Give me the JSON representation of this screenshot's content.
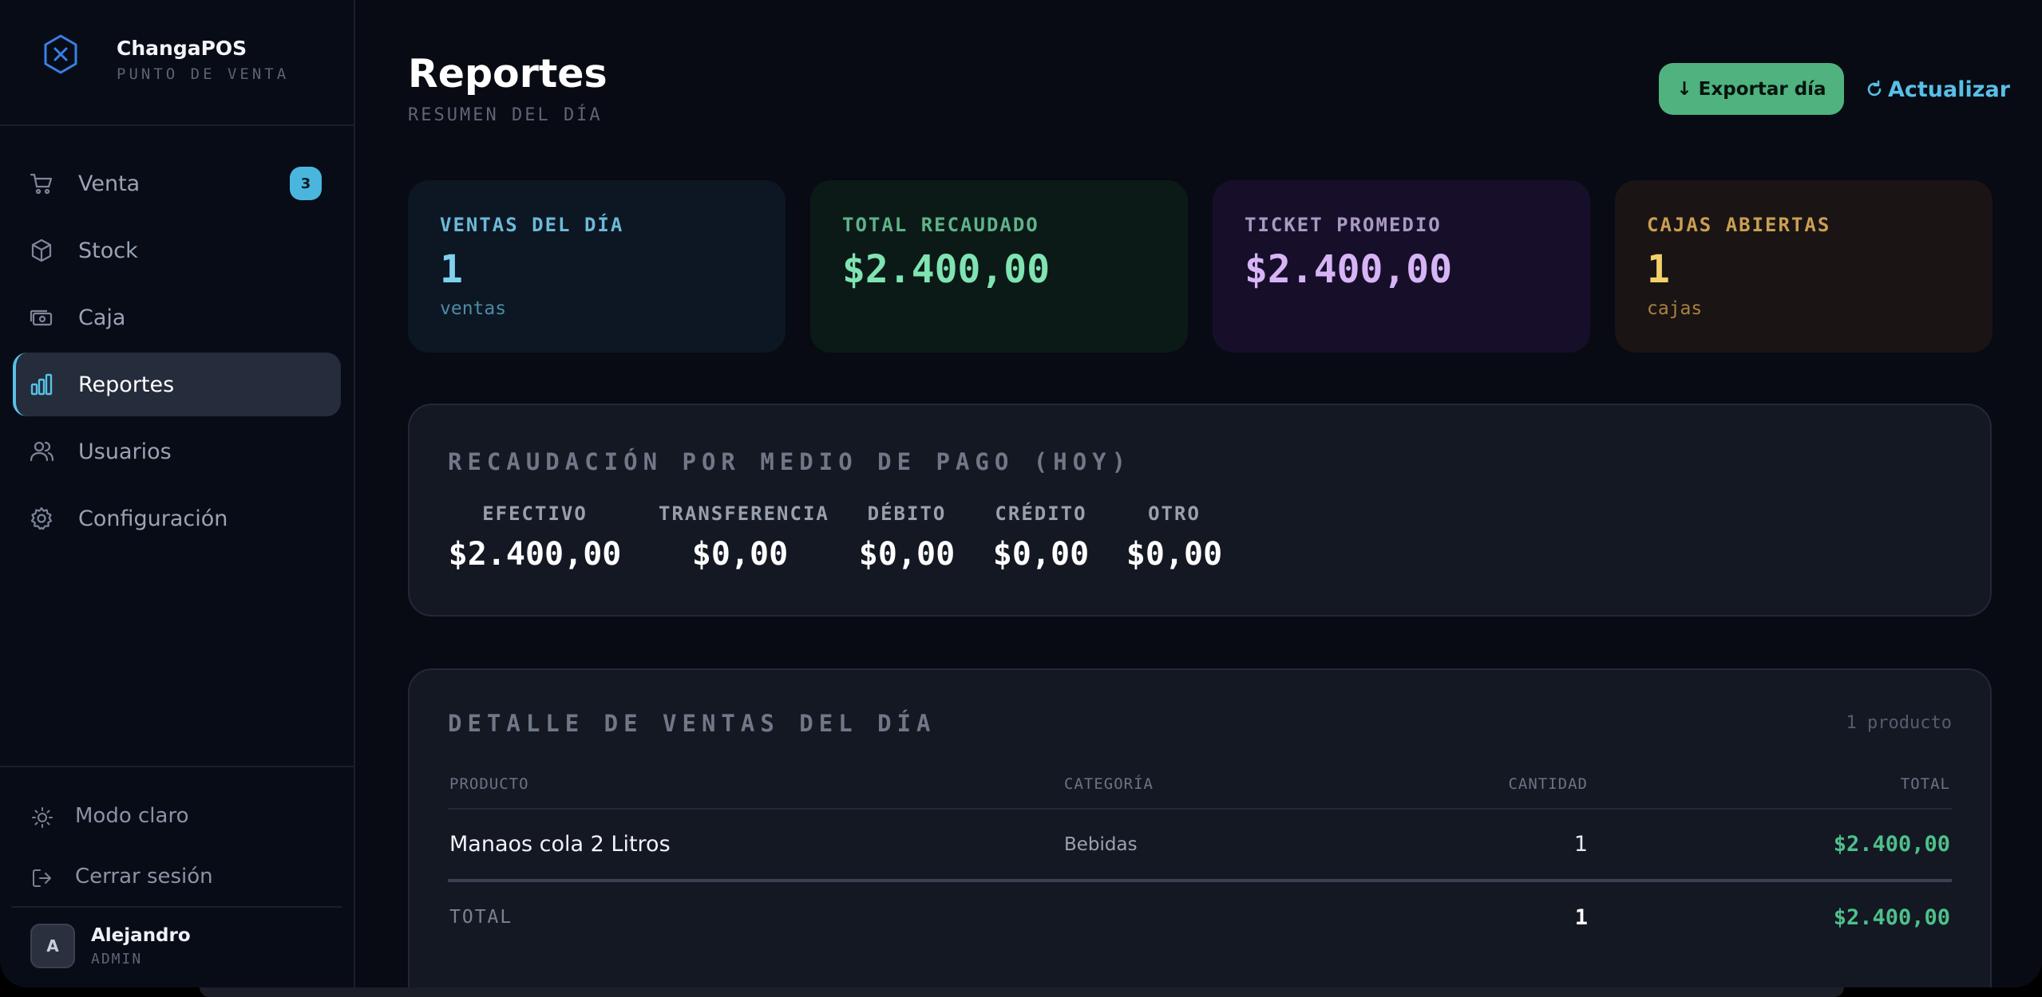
{
  "brand": {
    "name": "ChangaPOS",
    "subtitle": "PUNTO DE VENTA",
    "icon": "hex-x-logo-icon"
  },
  "sidebar": {
    "items": [
      {
        "label": "Venta",
        "icon": "cart-icon",
        "badge": "3"
      },
      {
        "label": "Stock",
        "icon": "box-icon"
      },
      {
        "label": "Caja",
        "icon": "cash-register-icon"
      },
      {
        "label": "Reportes",
        "icon": "bar-chart-icon",
        "active": true
      },
      {
        "label": "Usuarios",
        "icon": "users-icon"
      },
      {
        "label": "Configuración",
        "icon": "gear-icon"
      }
    ],
    "utilities": [
      {
        "label": "Modo claro",
        "icon": "sun-icon"
      },
      {
        "label": "Cerrar sesión",
        "icon": "logout-icon"
      }
    ],
    "user": {
      "initial": "A",
      "name": "Alejandro",
      "role": "ADMIN"
    }
  },
  "header": {
    "title": "Reportes",
    "subtitle": "RESUMEN DEL DÍA",
    "export_label": "↓ Exportar día",
    "refresh_label": "Actualizar",
    "refresh_icon": "refresh-icon"
  },
  "stats": [
    {
      "label": "VENTAS DEL DÍA",
      "value": "1",
      "unit": "ventas",
      "accent": "#7fd1ef"
    },
    {
      "label": "TOTAL RECAUDADO",
      "value": "$2.400,00",
      "unit": "",
      "accent": "#7fe3b2"
    },
    {
      "label": "TICKET PROMEDIO",
      "value": "$2.400,00",
      "unit": "",
      "accent": "#d7b4f6"
    },
    {
      "label": "CAJAS ABIERTAS",
      "value": "1",
      "unit": "cajas",
      "accent": "#f3d06a"
    }
  ],
  "payment": {
    "title": "RECAUDACIÓN POR MEDIO DE PAGO (HOY)",
    "methods": [
      {
        "label": "EFECTIVO",
        "amount": "$2.400,00"
      },
      {
        "label": "TRANSFERENCIA",
        "amount": "$0,00"
      },
      {
        "label": "DÉBITO",
        "amount": "$0,00"
      },
      {
        "label": "CRÉDITO",
        "amount": "$0,00"
      },
      {
        "label": "OTRO",
        "amount": "$0,00"
      }
    ]
  },
  "detail": {
    "title": "DETALLE DE VENTAS DEL DÍA",
    "count": "1 producto",
    "columns": [
      "PRODUCTO",
      "CATEGORÍA",
      "CANTIDAD",
      "TOTAL"
    ],
    "rows": [
      {
        "product": "Manaos cola 2 Litros",
        "category": "Bebidas",
        "quantity": "1",
        "total": "$2.400,00"
      }
    ],
    "footer": {
      "label": "TOTAL",
      "quantity": "1",
      "total": "$2.400,00"
    }
  }
}
